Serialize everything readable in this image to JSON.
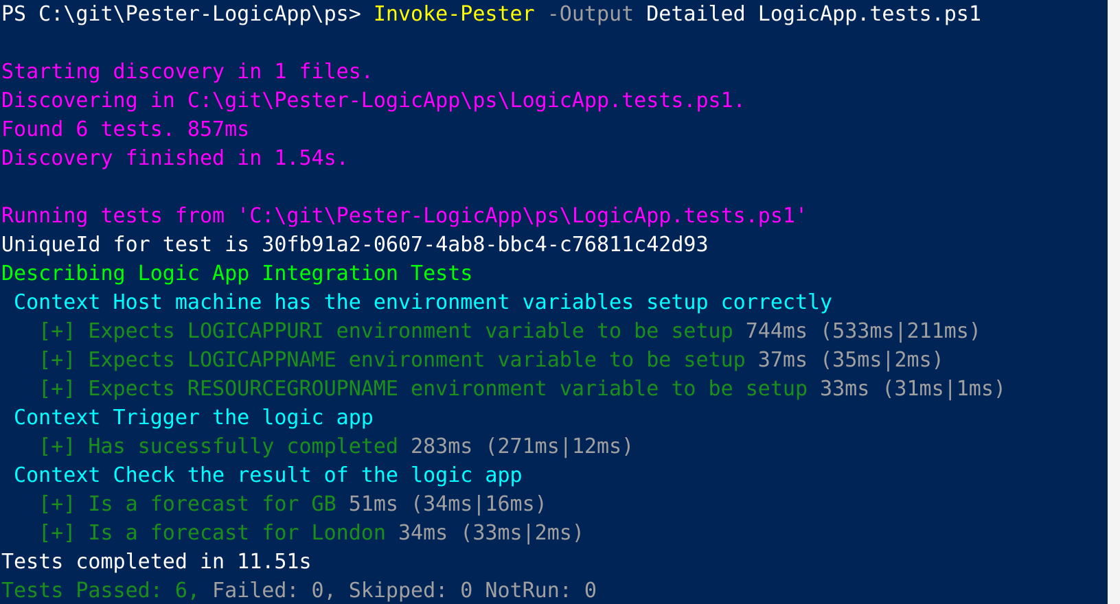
{
  "window": {
    "background": "#012456",
    "scrollbar_track": "#f4f4f4"
  },
  "colors": {
    "white": "#ffffff",
    "yellow": "#ffff00",
    "gray": "#a0a0a0",
    "magenta": "#ff00ff",
    "green": "#00ff00",
    "cyan": "#00ffff",
    "darkgreen": "#1b8f1b"
  },
  "lines": [
    {
      "name": "prompt-line",
      "segments": [
        {
          "text": "PS C:\\git\\Pester-LogicApp\\ps> ",
          "color": "white",
          "name": "prompt-path"
        },
        {
          "text": "Invoke-Pester",
          "color": "yellow",
          "name": "command-name"
        },
        {
          "text": " -Output",
          "color": "gray",
          "name": "parameter-output"
        },
        {
          "text": " Detailed LogicApp.tests.ps1",
          "color": "white",
          "name": "command-arguments"
        }
      ]
    },
    {
      "name": "blank-line",
      "segments": []
    },
    {
      "name": "discovery-start-line",
      "segments": [
        {
          "text": "Starting discovery in 1 files.",
          "color": "magenta",
          "name": "discovery-start-text"
        }
      ]
    },
    {
      "name": "discovering-line",
      "segments": [
        {
          "text": "Discovering in C:\\git\\Pester-LogicApp\\ps\\LogicApp.tests.ps1.",
          "color": "magenta",
          "name": "discovering-text"
        }
      ]
    },
    {
      "name": "found-tests-line",
      "segments": [
        {
          "text": "Found 6 tests. 857ms",
          "color": "magenta",
          "name": "found-tests-text"
        }
      ]
    },
    {
      "name": "discovery-finished-line",
      "segments": [
        {
          "text": "Discovery finished in 1.54s.",
          "color": "magenta",
          "name": "discovery-finished-text"
        }
      ]
    },
    {
      "name": "blank-line",
      "segments": []
    },
    {
      "name": "running-tests-line",
      "segments": [
        {
          "text": "Running tests from 'C:\\git\\Pester-LogicApp\\ps\\LogicApp.tests.ps1'",
          "color": "magenta",
          "name": "running-tests-text"
        }
      ]
    },
    {
      "name": "unique-id-line",
      "segments": [
        {
          "text": "UniqueId for test is 30fb91a2-0607-4ab8-bbc4-c76811c42d93",
          "color": "white",
          "name": "unique-id-text"
        }
      ]
    },
    {
      "name": "describe-line",
      "segments": [
        {
          "text": "Describing Logic App Integration Tests",
          "color": "green",
          "name": "describe-text"
        }
      ]
    },
    {
      "name": "context-line",
      "segments": [
        {
          "text": " Context Host machine has the environment variables setup correctly",
          "color": "cyan",
          "name": "context-text"
        }
      ]
    },
    {
      "name": "test-result-line",
      "segments": [
        {
          "text": "   [+] Expects LOGICAPPURI environment variable to be setup",
          "color": "darkgreen",
          "name": "test-name"
        },
        {
          "text": " 744ms (533ms|211ms)",
          "color": "gray",
          "name": "test-timing"
        }
      ]
    },
    {
      "name": "test-result-line",
      "segments": [
        {
          "text": "   [+] Expects LOGICAPPNAME environment variable to be setup",
          "color": "darkgreen",
          "name": "test-name"
        },
        {
          "text": " 37ms (35ms|2ms)",
          "color": "gray",
          "name": "test-timing"
        }
      ]
    },
    {
      "name": "test-result-line",
      "segments": [
        {
          "text": "   [+] Expects RESOURCEGROUPNAME environment variable to be setup",
          "color": "darkgreen",
          "name": "test-name"
        },
        {
          "text": " 33ms (31ms|1ms)",
          "color": "gray",
          "name": "test-timing"
        }
      ]
    },
    {
      "name": "context-line",
      "segments": [
        {
          "text": " Context Trigger the logic app",
          "color": "cyan",
          "name": "context-text"
        }
      ]
    },
    {
      "name": "test-result-line",
      "segments": [
        {
          "text": "   [+] Has sucessfully completed",
          "color": "darkgreen",
          "name": "test-name"
        },
        {
          "text": " 283ms (271ms|12ms)",
          "color": "gray",
          "name": "test-timing"
        }
      ]
    },
    {
      "name": "context-line",
      "segments": [
        {
          "text": " Context Check the result of the logic app",
          "color": "cyan",
          "name": "context-text"
        }
      ]
    },
    {
      "name": "test-result-line",
      "segments": [
        {
          "text": "   [+] Is a forecast for GB",
          "color": "darkgreen",
          "name": "test-name"
        },
        {
          "text": " 51ms (34ms|16ms)",
          "color": "gray",
          "name": "test-timing"
        }
      ]
    },
    {
      "name": "test-result-line",
      "segments": [
        {
          "text": "   [+] Is a forecast for London",
          "color": "darkgreen",
          "name": "test-name"
        },
        {
          "text": " 34ms (33ms|2ms)",
          "color": "gray",
          "name": "test-timing"
        }
      ]
    },
    {
      "name": "tests-completed-line",
      "segments": [
        {
          "text": "Tests completed in 11.51s",
          "color": "white",
          "name": "tests-completed-text"
        }
      ]
    },
    {
      "name": "summary-line",
      "segments": [
        {
          "text": "Tests Passed: 6, ",
          "color": "darkgreen",
          "name": "tests-passed-count"
        },
        {
          "text": "Failed: 0, Skipped: 0 NotRun: 0",
          "color": "gray",
          "name": "tests-other-counts"
        }
      ]
    }
  ]
}
